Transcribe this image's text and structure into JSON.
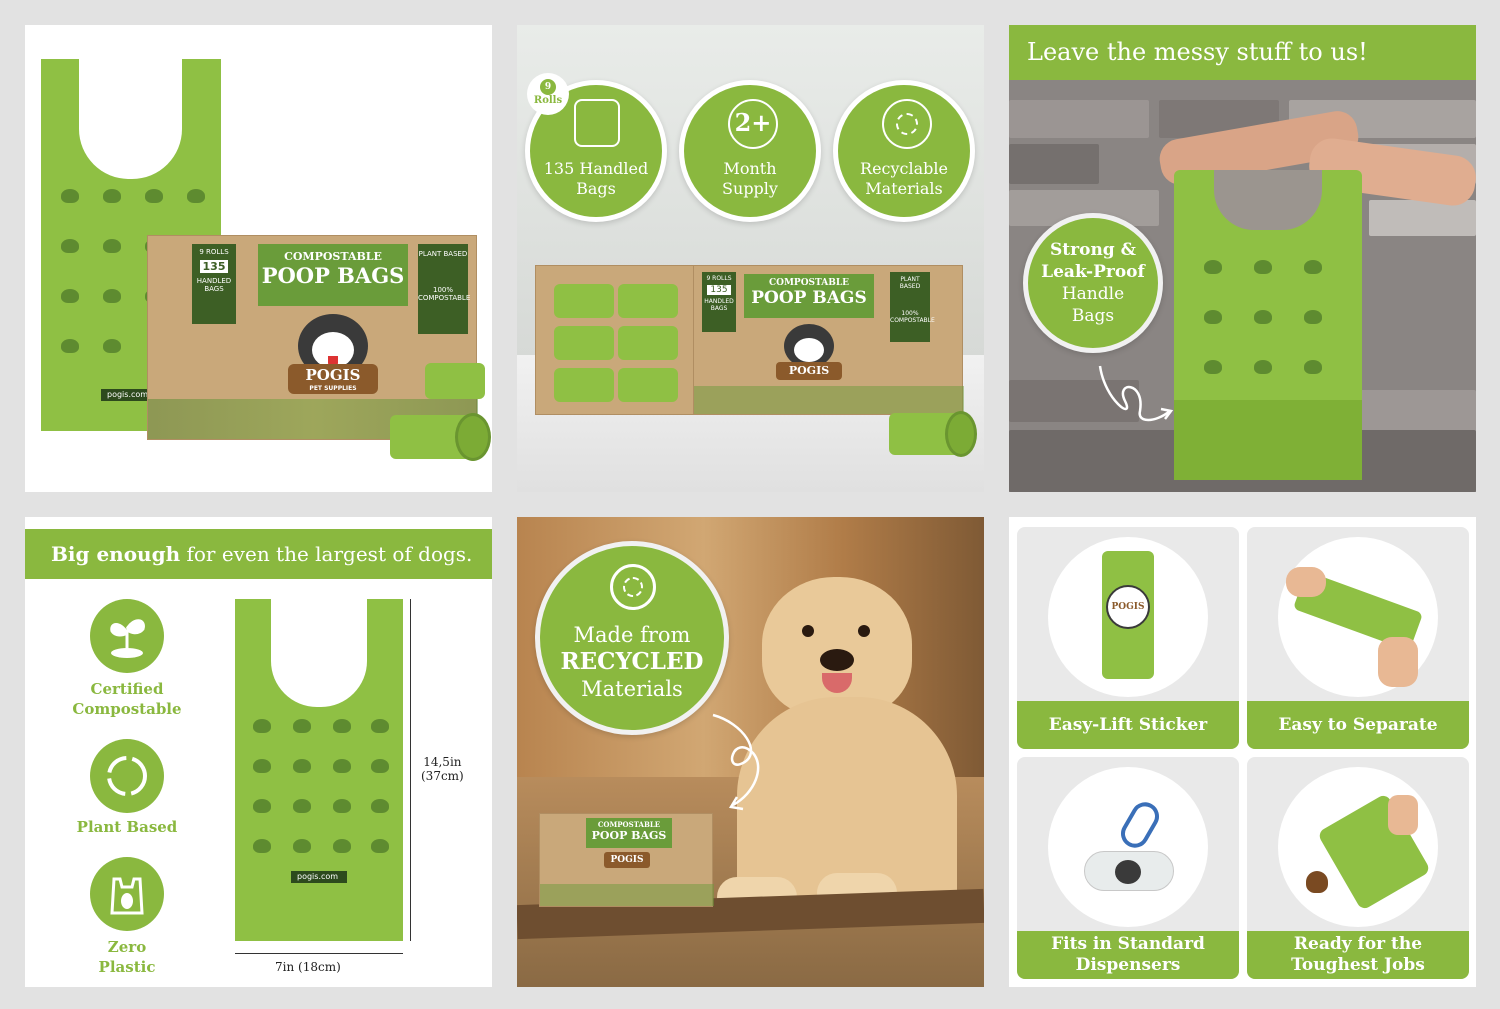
{
  "panel1": {
    "box_top_label": "COMPOSTABLE",
    "box_main_label": "POOP BAGS",
    "box_rolls": "9 ROLLS",
    "box_count": "135",
    "box_count_label": "HANDLED BAGS",
    "box_plant": "PLANT BASED",
    "box_compost": "100% COMPOSTABLE",
    "brand": "POGIS",
    "brand_sub": "PET SUPPLIES",
    "url": "pogis.com"
  },
  "panel2": {
    "rolls_badge_num": "9",
    "rolls_badge_label": "Rolls",
    "badges": [
      {
        "line1": "135 Handled",
        "line2": "Bags"
      },
      {
        "icon": "2+",
        "line1": "Month",
        "line2": "Supply"
      },
      {
        "line1": "Recyclable",
        "line2": "Materials"
      }
    ],
    "box_top_label": "COMPOSTABLE",
    "box_main_label": "POOP BAGS",
    "box_rolls": "9 ROLLS",
    "box_count": "135",
    "box_count_label": "HANDLED BAGS",
    "box_plant": "PLANT BASED",
    "box_compost": "100% COMPOSTABLE",
    "brand": "POGIS"
  },
  "panel3": {
    "heading": "Leave the messy stuff to us!",
    "badge_line1": "Strong &",
    "badge_line2": "Leak-Proof",
    "badge_line3": "Handle",
    "badge_line4": "Bags"
  },
  "panel4": {
    "heading_bold": "Big enough",
    "heading_rest": " for even the largest of dogs.",
    "features": [
      {
        "line1": "Certified",
        "line2": "Compostable"
      },
      {
        "line1": "Plant Based",
        "line2": ""
      },
      {
        "line1": "Zero",
        "line2": "Plastic"
      }
    ],
    "height_in": "14,5in",
    "height_cm": "(37cm)",
    "width": "7in (18cm)",
    "url": "pogis.com"
  },
  "panel5": {
    "line1": "Made from",
    "line2": "RECYCLED",
    "line3": "Materials",
    "box_top_label": "COMPOSTABLE",
    "box_main_label": "POOP BAGS",
    "brand": "POGIS"
  },
  "panel6": {
    "tiles": [
      {
        "label": "Easy-Lift Sticker"
      },
      {
        "label": "Easy to Separate"
      },
      {
        "label_line1": "Fits in Standard",
        "label_line2": "Dispensers"
      },
      {
        "label_line1": "Ready for the",
        "label_line2": "Toughest Jobs"
      }
    ],
    "sticker_brand": "POGIS"
  },
  "colors": {
    "accent": "#8ab83f",
    "bag": "#8fc044",
    "dark_green": "#4e7a2a",
    "kraft": "#c9a87a"
  }
}
